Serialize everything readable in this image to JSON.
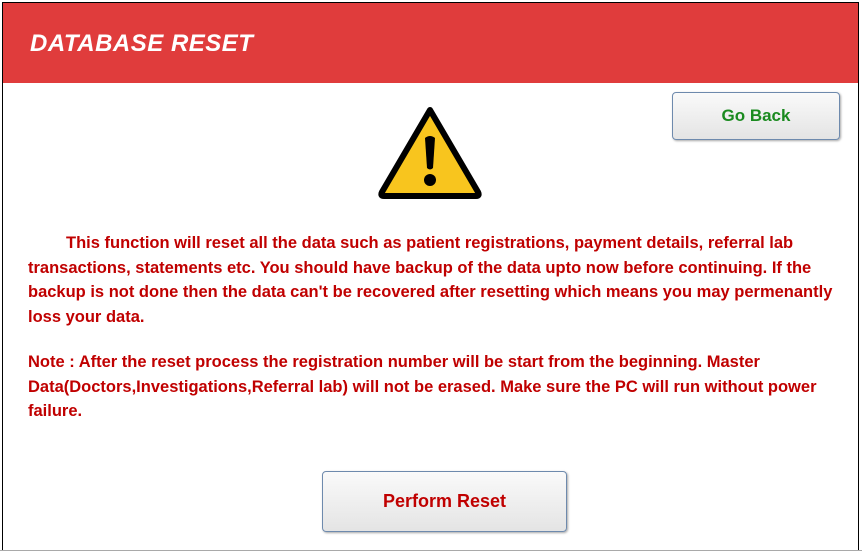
{
  "header": {
    "title": "DATABASE RESET",
    "bg_color": "#e03c3c"
  },
  "buttons": {
    "go_back": "Go Back",
    "perform_reset": "Perform Reset"
  },
  "icon": {
    "name": "warning-icon",
    "fill": "#f8c51e",
    "stroke": "#000000"
  },
  "message": {
    "paragraph": "This function will reset all the data such as patient registrations, payment details, referral lab transactions, statements etc. You should have backup of the data upto now before continuing. If the backup is not done then the data can't be recovered after resetting which means you may permenantly loss your data.",
    "note": "Note : After the reset process the registration number will be start from the beginning. Master Data(Doctors,Investigations,Referral lab) will not be erased. Make sure the PC will run without power failure.",
    "color": "#c00000"
  }
}
